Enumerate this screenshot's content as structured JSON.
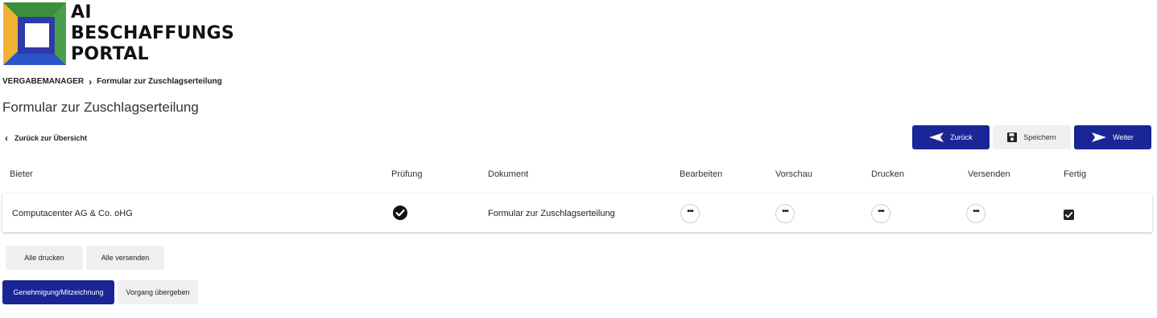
{
  "logo": {
    "line1": "AI",
    "line2": "BESCHAFFUNGS",
    "line3": "PORTAL",
    "colors": [
      "#f2b233",
      "#3a8f3b",
      "#2b56c7",
      "#2f3aa8"
    ]
  },
  "breadcrumb": {
    "root": "VERGABEMANAGER",
    "current": "Formular zur Zuschlagserteilung"
  },
  "page_title": "Formular zur Zuschlagserteilung",
  "back_link": "Zurück zur Übersicht",
  "toolbar": {
    "back_label": "Zurück",
    "save_label": "Speichern",
    "next_label": "Weiter"
  },
  "table": {
    "headers": {
      "bieter": "Bieter",
      "pruefung": "Prüfung",
      "dokument": "Dokument",
      "bearbeiten": "Bearbeiten",
      "vorschau": "Vorschau",
      "drucken": "Drucken",
      "versenden": "Versenden",
      "fertig": "Fertig"
    },
    "rows": [
      {
        "bieter": "Computacenter AG & Co. oHG",
        "pruefung": "checked",
        "dokument": "Formular zur Zuschlagserteilung",
        "fertig": true
      }
    ]
  },
  "actions": {
    "print_all": "Alle drucken",
    "send_all": "Alle versenden",
    "approval": "Genehmigung/Mitzeichnung",
    "handover": "Vorgang übergeben"
  },
  "colors": {
    "primary": "#1a2596",
    "light_button": "#f0f0f0"
  }
}
